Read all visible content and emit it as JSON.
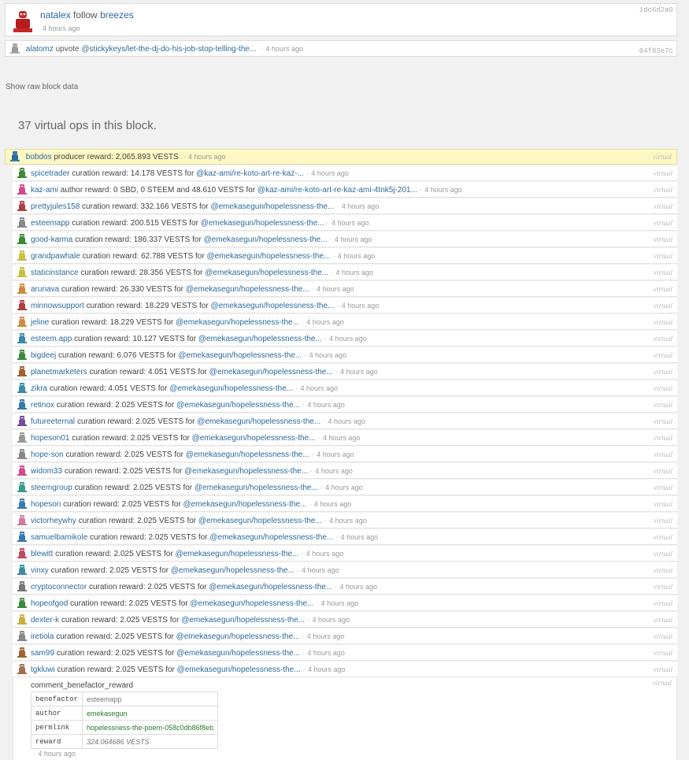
{
  "top_ops": [
    {
      "user": "natalex",
      "action": "follow",
      "target": "breezes",
      "time": "4 hours ago",
      "hash": "1dc6d2a0"
    },
    {
      "user": "alatomz",
      "action": "upvote",
      "target": "@stickykeys/let-the-dj-do-his-job-stop-telling-the...",
      "time": "4 hours ago",
      "hash": "04f83e7c"
    }
  ],
  "raw_link": "Show raw block data",
  "virtual_heading": "37 virtual ops in this block.",
  "virtual_label": "virtual",
  "producer": {
    "user": "bobdos",
    "text": "producer reward: 2,065.893 VESTS",
    "time": "4 hours ago"
  },
  "ops": [
    {
      "user": "spicetrader",
      "text": "curation reward: 14.178 VESTS for",
      "link": "@kaz-ami/re-koto-art-re-kaz-...",
      "time": "4 hours ago",
      "color": "#3a8a3a"
    },
    {
      "user": "kaz-ami",
      "text": "author reward: 0 SBD, 0 STEEM and 48.610 VESTS for",
      "link": "@kaz-ami/re-koto-art-re-kaz-ami-4tnk5j-201...",
      "time": "4 hours ago",
      "color": "#d04a8a"
    },
    {
      "user": "prettyjules158",
      "text": "curation reward: 332.166 VESTS for",
      "link": "@emekasegun/hopelessness-the...",
      "time": "4 hours ago",
      "color": "#b04040"
    },
    {
      "user": "esteemapp",
      "text": "curation reward: 200.515 VESTS for",
      "link": "@emekasegun/hopelessness-the...",
      "time": "4 hours ago",
      "color": "#888888"
    },
    {
      "user": "good-karma",
      "text": "curation reward: 186.337 VESTS for",
      "link": "@emekasegun/hopelessness-the...",
      "time": "4 hours ago",
      "color": "#3a8a3a"
    },
    {
      "user": "grandpawhale",
      "text": "curation reward: 62.788 VESTS for",
      "link": "@emekasegun/hopelessness-the...",
      "time": "4 hours ago",
      "color": "#c8c040"
    },
    {
      "user": "staticinstance",
      "text": "curation reward: 28.356 VESTS for",
      "link": "@emekasegun/hopelessness-the...",
      "time": "4 hours ago",
      "color": "#c8c040"
    },
    {
      "user": "arunava",
      "text": "curation reward: 26.330 VESTS for",
      "link": "@emekasegun/hopelessness-the...",
      "time": "4 hours ago",
      "color": "#d08a40"
    },
    {
      "user": "minnowsupport",
      "text": "curation reward: 18.229 VESTS for",
      "link": "@emekasegun/hopelessness-the...",
      "time": "4 hours ago",
      "color": "#b04040"
    },
    {
      "user": "jeline",
      "text": "curation reward: 18.229 VESTS for",
      "link": "@emekasegun/hopelessness-the...",
      "time": "4 hours ago",
      "color": "#d08a40"
    },
    {
      "user": "esteem.app",
      "text": "curation reward: 10.127 VESTS for",
      "link": "@emekasegun/hopelessness-the...",
      "time": "4 hours ago",
      "color": "#3a8aa8"
    },
    {
      "user": "bigdeej",
      "text": "curation reward: 6.076 VESTS for",
      "link": "@emekasegun/hopelessness-the...",
      "time": "4 hours ago",
      "color": "#3a8a3a"
    },
    {
      "user": "planetmarketers",
      "text": "curation reward: 4.051 VESTS for",
      "link": "@emekasegun/hopelessness-the...",
      "time": "4 hours ago",
      "color": "#a06030"
    },
    {
      "user": "zikra",
      "text": "curation reward: 4.051 VESTS for",
      "link": "@emekasegun/hopelessness-the...",
      "time": "4 hours ago",
      "color": "#3a8aa8"
    },
    {
      "user": "retinox",
      "text": "curation reward: 2.025 VESTS for",
      "link": "@emekasegun/hopelessness-the...",
      "time": "4 hours ago",
      "color": "#3a7aa8"
    },
    {
      "user": "futureeternal",
      "text": "curation reward: 2.025 VESTS for",
      "link": "@emekasegun/hopelessness-the...",
      "time": "4 hours ago",
      "color": "#7a4a9a"
    },
    {
      "user": "hopeson01",
      "text": "curation reward: 2.025 VESTS for",
      "link": "@emekasegun/hopelessness-the...",
      "time": "4 hours ago",
      "color": "#999999"
    },
    {
      "user": "hope-son",
      "text": "curation reward: 2.025 VESTS for",
      "link": "@emekasegun/hopelessness-the...",
      "time": "4 hours ago",
      "color": "#888888"
    },
    {
      "user": "widom33",
      "text": "curation reward: 2.025 VESTS for",
      "link": "@emekasegun/hopelessness-the...",
      "time": "4 hours ago",
      "color": "#d04a8a"
    },
    {
      "user": "steemgroup",
      "text": "curation reward: 2.025 VESTS for",
      "link": "@emekasegun/hopelessness-the...",
      "time": "4 hours ago",
      "color": "#3a9a8a"
    },
    {
      "user": "hopeson",
      "text": "curation reward: 2.025 VESTS for",
      "link": "@emekasegun/hopelessness-the...",
      "time": "4 hours ago",
      "color": "#3a7aa8"
    },
    {
      "user": "victorheywhy",
      "text": "curation reward: 2.025 VESTS for",
      "link": "@emekasegun/hopelessness-the...",
      "time": "4 hours ago",
      "color": "#d07aa0"
    },
    {
      "user": "samuelbamikole",
      "text": "curation reward: 2.025 VESTS for",
      "link": "@emekasegun/hopelessness-the...",
      "time": "4 hours ago",
      "color": "#3a7aa8"
    },
    {
      "user": "blewitt",
      "text": "curation reward: 2.025 VESTS for",
      "link": "@emekasegun/hopelessness-the...",
      "time": "4 hours ago",
      "color": "#c04a60"
    },
    {
      "user": "vinxy",
      "text": "curation reward: 2.025 VESTS for",
      "link": "@emekasegun/hopelessness-the...",
      "time": "4 hours ago",
      "color": "#3a8aa8"
    },
    {
      "user": "cryptoconnector",
      "text": "curation reward: 2.025 VESTS for",
      "link": "@emekasegun/hopelessness-the...",
      "time": "4 hours ago",
      "color": "#777777"
    },
    {
      "user": "hopeofgod",
      "text": "curation reward: 2.025 VESTS for",
      "link": "@emekasegun/hopelessness-the...",
      "time": "4 hours ago",
      "color": "#3a8a3a"
    },
    {
      "user": "dexter-k",
      "text": "curation reward: 2.025 VESTS for",
      "link": "@emekasegun/hopelessness-the...",
      "time": "4 hours ago",
      "color": "#c8b040"
    },
    {
      "user": "iretiola",
      "text": "curation reward: 2.025 VESTS for",
      "link": "@emekasegun/hopelessness-the...",
      "time": "4 hours ago",
      "color": "#888888"
    },
    {
      "user": "sam99",
      "text": "curation reward: 2.025 VESTS for",
      "link": "@emekasegun/hopelessness-the...",
      "time": "4 hours ago",
      "color": "#a06030"
    },
    {
      "user": "tgkluwi",
      "text": "curation reward: 2.025 VESTS for",
      "link": "@emekasegun/hopelessness-the...",
      "time": "4 hours ago",
      "color": "#a07050"
    }
  ],
  "benefactor": {
    "title": "comment_benefactor_reward",
    "rows": [
      {
        "key": "benefactor",
        "value": "esteemapp"
      },
      {
        "key": "author",
        "value": "emekasegun"
      },
      {
        "key": "permlink",
        "value": "hopelessness-the-poem-058c0db86f8eb"
      },
      {
        "key": "reward",
        "value": "324.064686 VESTS"
      }
    ],
    "time": "4 hours ago"
  }
}
